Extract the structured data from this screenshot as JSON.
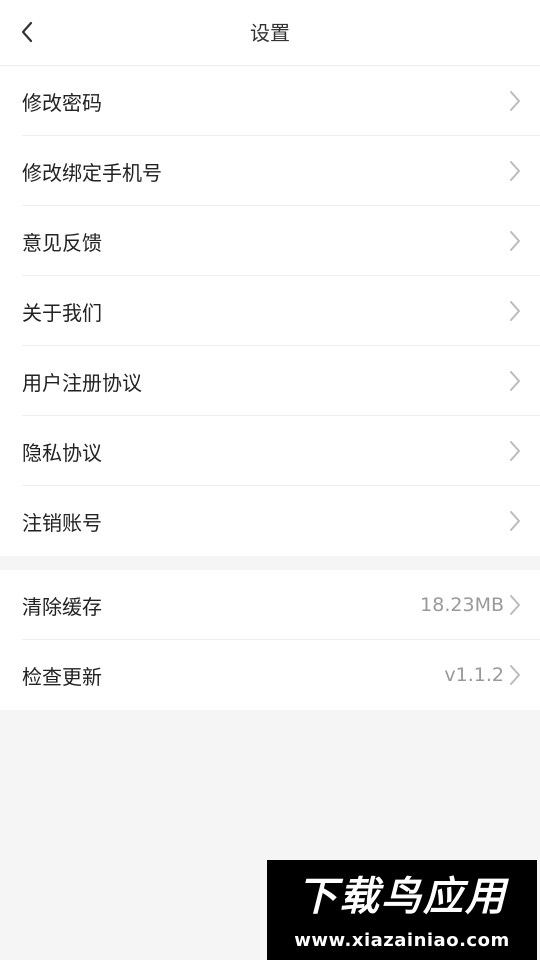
{
  "header": {
    "title": "设置"
  },
  "groups": [
    {
      "items": [
        {
          "label": "修改密码"
        },
        {
          "label": "修改绑定手机号"
        },
        {
          "label": "意见反馈"
        },
        {
          "label": "关于我们"
        },
        {
          "label": "用户注册协议"
        },
        {
          "label": "隐私协议"
        },
        {
          "label": "注销账号"
        }
      ]
    },
    {
      "items": [
        {
          "label": "清除缓存",
          "value": "18.23MB"
        },
        {
          "label": "检查更新",
          "value": "v1.1.2"
        }
      ]
    }
  ],
  "watermark": {
    "title": "下载鸟应用",
    "url": "www.xiazainiao.com"
  },
  "colors": {
    "background": "#f5f5f5",
    "card": "#ffffff",
    "chevron": "#bbbbbb",
    "value_text": "#999999"
  }
}
